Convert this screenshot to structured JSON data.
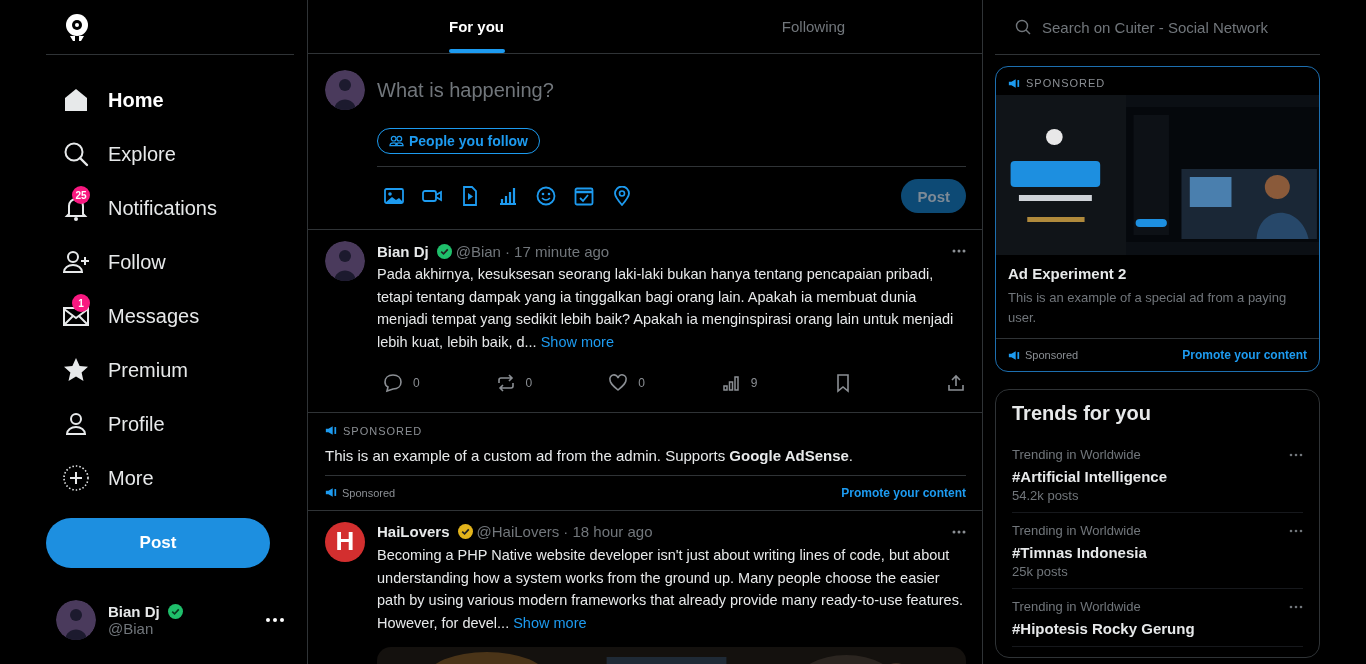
{
  "nav": {
    "items": [
      {
        "label": "Home",
        "selected": true
      },
      {
        "label": "Explore",
        "selected": false
      },
      {
        "label": "Notifications",
        "selected": false,
        "badge": "25"
      },
      {
        "label": "Follow",
        "selected": false
      },
      {
        "label": "Messages",
        "selected": false,
        "badge": "1"
      },
      {
        "label": "Premium",
        "selected": false
      },
      {
        "label": "Profile",
        "selected": false
      },
      {
        "label": "More",
        "selected": false
      }
    ],
    "post_button": "Post",
    "account": {
      "name": "Bian Dj",
      "handle": "@Bian",
      "verified": true
    }
  },
  "tabs": [
    {
      "label": "For you",
      "selected": true
    },
    {
      "label": "Following",
      "selected": false
    }
  ],
  "composer": {
    "placeholder": "What is happening?",
    "audience": "People you follow",
    "post_button": "Post",
    "disabled": true
  },
  "feed": [
    {
      "kind": "post",
      "name": "Bian Dj",
      "color": "#1fbf6b",
      "handle": "@Bian",
      "time": "· 17 minute ago",
      "text": "Pada akhirnya, kesuksesan seorang laki-laki bukan hanya tentang pencapaian pribadi, tetapi tentang dampak yang ia tinggalkan bagi orang lain. Apakah ia membuat dunia menjadi tempat yang sedikit lebih baik? Apakah ia menginspirasi orang lain untuk menjadi lebih kuat, lebih baik, d...",
      "more": "Show more",
      "stats": {
        "replies": "0",
        "reposts": "0",
        "likes": "0",
        "views": "9"
      }
    },
    {
      "kind": "ad",
      "label": "SPONSORED",
      "text": "This is an example of a custom ad from the admin. Supports **Google AdSense**.",
      "footer": "Sponsored",
      "link": "Promote your content"
    },
    {
      "kind": "post",
      "avatar": {
        "kind": "letter",
        "text": "H"
      },
      "name": "HaiLovers",
      "color": "#e3b41b",
      "handle": "@HaiLovers",
      "time": "· 18 hour ago",
      "text": "Becoming a PHP Native website developer isn't just about writing lines of code, but about understanding how a system works from the ground up. Many people choose the easier path by using various modern frameworks that already provide many ready-to-use features. However, for devel...",
      "more": "Show more"
    }
  ],
  "search": {
    "placeholder": "Search on Cuiter - Social Network"
  },
  "side_ad": {
    "label": "SPONSORED",
    "title": "Ad Experiment 2",
    "text": "This is an example of a special ad from a paying user.",
    "footer": "Sponsored",
    "link": "Promote your content"
  },
  "trends": {
    "title": "Trends for you",
    "items": [
      {
        "context": "Trending in Worldwide",
        "tag": "#Artificial Intelligence",
        "count": "54.2k posts"
      },
      {
        "context": "Trending in Worldwide",
        "tag": "#Timnas Indonesia",
        "count": "25k posts"
      },
      {
        "context": "Trending in Worldwide",
        "tag": "#Hipotesis Rocky Gerung"
      }
    ]
  }
}
